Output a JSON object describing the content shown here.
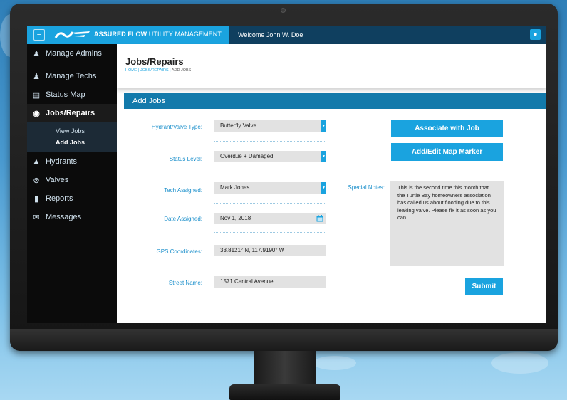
{
  "topbar": {
    "brand_name": "ASSURED FLOW",
    "brand_sub": " UTILITY MANAGEMENT",
    "welcome": "Welcome John W. Doe",
    "menu_icon": "hamburger-icon",
    "user_icon": "user-icon"
  },
  "sidebar": {
    "items": [
      {
        "label": "Manage Admins",
        "icon": "admin-icon"
      },
      {
        "label": "Manage Techs",
        "icon": "tech-icon"
      },
      {
        "label": "Status Map",
        "icon": "map-icon"
      },
      {
        "label": "Jobs/Repairs",
        "icon": "pin-icon"
      },
      {
        "label": "Hydrants",
        "icon": "hydrant-icon"
      },
      {
        "label": "Valves",
        "icon": "valve-icon"
      },
      {
        "label": "Reports",
        "icon": "document-icon"
      },
      {
        "label": "Messages",
        "icon": "envelope-icon"
      }
    ],
    "subitems": [
      {
        "label": "View Jobs"
      },
      {
        "label": "Add Jobs"
      }
    ]
  },
  "page": {
    "title": "Jobs/Repairs",
    "breadcrumb_home": "HOME",
    "breadcrumb_sep1": " | ",
    "breadcrumb_jobs": "JOBS/REPAIRS",
    "breadcrumb_sep2": " | ",
    "breadcrumb_current": "ADD JOBS"
  },
  "section": {
    "title": "Add Jobs"
  },
  "form": {
    "hydrant_label": "Hydrant/Valve Type:",
    "hydrant_value": "Butterfly Valve",
    "status_label": "Status Level:",
    "status_value": "Overdue + Damaged",
    "tech_label": "Tech Assigned:",
    "tech_value": "Mark Jones",
    "date_label": "Date Assigned:",
    "date_value": "Nov 1, 2018",
    "gps_label": "GPS Coordinates:",
    "gps_value": "33.8121° N, 117.9190° W",
    "street_label": "Street Name:",
    "street_value": "1571 Central Avenue",
    "notes_label": "Special Notes:",
    "notes_value": "This is the second time this month that the Turtle Bay homeowners association has called us about flooding due to this leaking valve. Please fix it as soon as you can."
  },
  "buttons": {
    "associate": "Associate with Job",
    "map_marker": "Add/Edit Map Marker",
    "submit": "Submit"
  },
  "colors": {
    "accent": "#1aa3df",
    "dark_nav": "#0f3f5f",
    "section": "#137aab",
    "field_bg": "#e2e2e2"
  }
}
